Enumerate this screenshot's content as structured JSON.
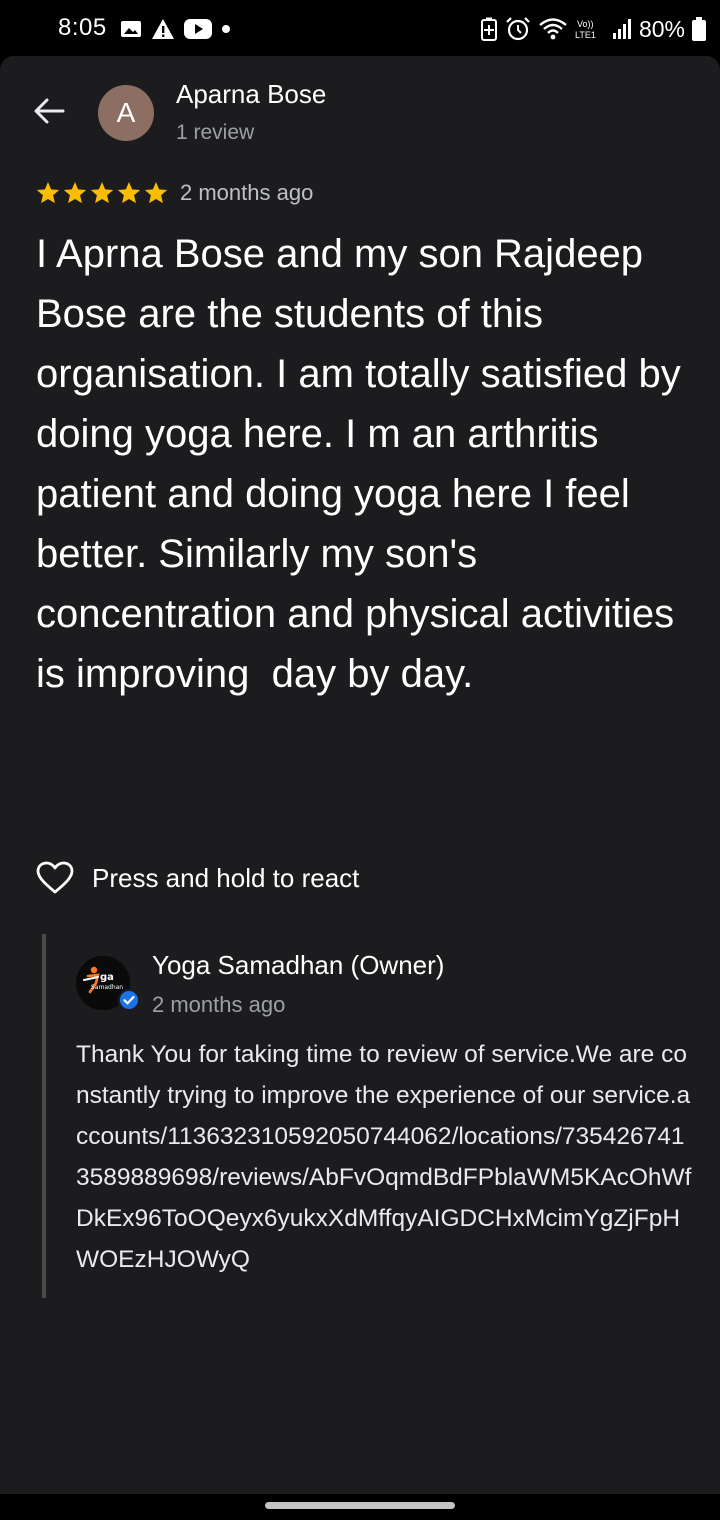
{
  "status_bar": {
    "time": "8:05",
    "battery": "80%",
    "icons": [
      "gallery-icon",
      "alert-icon",
      "youtube-icon",
      "dot-icon",
      "battery-saver-icon",
      "alarm-icon",
      "wifi-icon",
      "volte-icon",
      "signal-icon",
      "battery-icon"
    ],
    "volte_label": "Vo)) LTE1"
  },
  "header": {
    "back_icon": "arrow-left-icon",
    "avatar_letter": "A",
    "avatar_color": "#8d6e63",
    "reviewer_name": "Aparna Bose",
    "reviewer_meta": "1 review"
  },
  "review": {
    "rating": 5,
    "star_color": "#fbbc04",
    "time": "2 months ago",
    "text": "I Aprna Bose and my son Rajdeep Bose are the students of this organisation. I am totally satisfied by doing yoga here. I m an arthritis patient and doing yoga here I feel better. Similarly my son's concentration and physical activities is improving  day by day."
  },
  "react": {
    "icon": "heart-outline-icon",
    "label": "Press and hold to react"
  },
  "owner_reply": {
    "logo_text": "ga",
    "logo_subtext": "Samadhan",
    "name": "Yoga Samadhan (Owner)",
    "time": "2 months ago",
    "verified_color": "#1a73e8",
    "text": "Thank You for taking time to review of service.We are constantly trying to improve the experience of our service.accounts/113632310592050744062/locations/7354267413589889698/reviews/AbFvOqmdBdFPblaWM5KAcOhWfDkEx96ToOQeyx6yukxXdMffqyAIGDCHxMcimYgZjFpHWOEzHJOWyQ"
  }
}
